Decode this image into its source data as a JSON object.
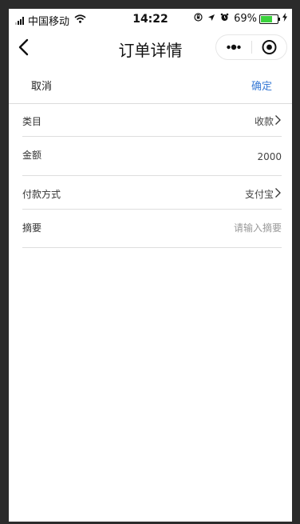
{
  "status_bar": {
    "carrier": "中国移动",
    "time": "14:22",
    "battery_percent": "69%",
    "battery_level": 0.69,
    "battery_color": "#3bd23d"
  },
  "nav": {
    "title": "订单详情",
    "back_icon": "chevron-left-icon",
    "more_icon": "more-dots-icon",
    "close_icon": "target-circle-icon"
  },
  "actions": {
    "cancel_label": "取消",
    "confirm_label": "确定",
    "confirm_color": "#3a7bd5"
  },
  "form": {
    "category": {
      "label": "类目",
      "value": "收款"
    },
    "amount": {
      "label": "金额",
      "value": "2000"
    },
    "payment_method": {
      "label": "付款方式",
      "value": "支付宝"
    },
    "summary": {
      "label": "摘要",
      "placeholder": "请输入摘要",
      "value": ""
    }
  }
}
